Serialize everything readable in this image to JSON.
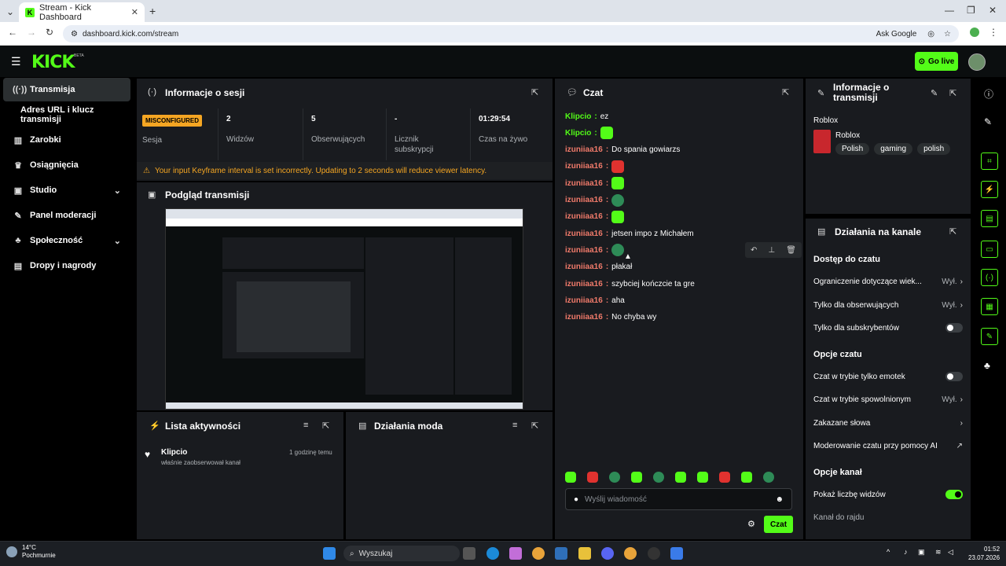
{
  "browser": {
    "tab_title": "Stream - Kick Dashboard",
    "url": "dashboard.kick.com/stream",
    "ask_google": "Ask Google"
  },
  "header": {
    "logo": "KICK",
    "beta": "BETA",
    "go_live": "Go live"
  },
  "sidebar": {
    "items": [
      {
        "label": "Transmisja",
        "icon": "broadcast-icon"
      },
      {
        "label": "Adres URL i klucz transmisji",
        "icon": ""
      },
      {
        "label": "Zarobki",
        "icon": "chart-icon"
      },
      {
        "label": "Osiągnięcia",
        "icon": "trophy-icon"
      },
      {
        "label": "Studio",
        "icon": "studio-icon"
      },
      {
        "label": "Panel moderacji",
        "icon": "wrench-icon"
      },
      {
        "label": "Społeczność",
        "icon": "community-icon"
      },
      {
        "label": "Dropy i nagrody",
        "icon": "gift-icon"
      }
    ]
  },
  "session": {
    "title": "Informacje o sesji",
    "badge": "MISCONFIGURED",
    "status_label": "Sesja",
    "stats": [
      {
        "value": "2",
        "label": "Widzów"
      },
      {
        "value": "5",
        "label": "Obserwujących"
      },
      {
        "value": "-",
        "label": "Licznik subskrypcji"
      },
      {
        "value": "01:29:54",
        "label": "Czas na żywo"
      }
    ],
    "warning": "Your input Keyframe interval is set incorrectly. Updating to 2 seconds will reduce viewer latency."
  },
  "preview": {
    "title": "Podgląd transmisji"
  },
  "activity": {
    "title": "Lista aktywności",
    "items": [
      {
        "user": "Klipcio",
        "text": "właśnie zaobserwował kanał",
        "time": "1 godzinę temu"
      }
    ]
  },
  "mod_actions": {
    "title": "Działania moda"
  },
  "chat": {
    "title": "Czat",
    "messages": [
      {
        "user": "Klipcio",
        "text": "ez",
        "color": "#53fc18",
        "emote": ""
      },
      {
        "user": "Klipcio",
        "text": "",
        "color": "#53fc18",
        "emote": "green"
      },
      {
        "user": "izuniiaa16",
        "text": "Do spania gowiarzs",
        "color": "#f07a6a",
        "emote": ""
      },
      {
        "user": "izuniiaa16",
        "text": "",
        "color": "#f07a6a",
        "emote": "red"
      },
      {
        "user": "izuniiaa16",
        "text": "",
        "color": "#f07a6a",
        "emote": "green"
      },
      {
        "user": "izuniiaa16",
        "text": "",
        "color": "#f07a6a",
        "emote": "globe"
      },
      {
        "user": "izuniiaa16",
        "text": "",
        "color": "#f07a6a",
        "emote": "green"
      },
      {
        "user": "izuniiaa16",
        "text": "jetsen impo z Michałem",
        "color": "#f07a6a",
        "emote": ""
      },
      {
        "user": "izuniiaa16",
        "text": "",
        "color": "#f07a6a",
        "emote": "globe"
      },
      {
        "user": "izuniiaa16",
        "text": "płakał",
        "color": "#f07a6a",
        "emote": ""
      },
      {
        "user": "izuniiaa16",
        "text": "szybciej kończcie ta gre",
        "color": "#f07a6a",
        "emote": ""
      },
      {
        "user": "izuniiaa16",
        "text": "aha",
        "color": "#f07a6a",
        "emote": ""
      },
      {
        "user": "izuniiaa16",
        "text": "No chyba wy",
        "color": "#f07a6a",
        "emote": ""
      }
    ],
    "input_placeholder": "Wyślij wiadomość",
    "send": "Czat"
  },
  "stream_info": {
    "title": "Informacje o transmisji",
    "category_header": "Roblox",
    "category": "Roblox",
    "tags": [
      "Polish",
      "gaming",
      "polish"
    ]
  },
  "channel_actions": {
    "title": "Działania na kanale",
    "sections": [
      {
        "heading": "Dostęp do czatu",
        "rows": [
          {
            "label": "Ograniczenie dotyczące wiek...",
            "value": "Wył.",
            "control": "arrow"
          },
          {
            "label": "Tylko dla obserwujących",
            "value": "Wył.",
            "control": "arrow"
          },
          {
            "label": "Tylko dla subskrybentów",
            "value": "",
            "control": "toggle-off"
          }
        ]
      },
      {
        "heading": "Opcje czatu",
        "rows": [
          {
            "label": "Czat w trybie tylko emotek",
            "value": "",
            "control": "toggle-off"
          },
          {
            "label": "Czat w trybie spowolnionym",
            "value": "Wył.",
            "control": "arrow"
          },
          {
            "label": "Zakazane słowa",
            "value": "",
            "control": "arrow"
          },
          {
            "label": "Moderowanie czatu przy pomocy AI",
            "value": "",
            "control": "external"
          }
        ]
      },
      {
        "heading": "Opcje kanał",
        "rows": [
          {
            "label": "Pokaż liczbę widzów",
            "value": "",
            "control": "toggle-on"
          },
          {
            "label": "Kanał do rajdu",
            "value": "",
            "control": "none"
          }
        ]
      }
    ]
  },
  "taskbar": {
    "weather_temp": "14°C",
    "weather_desc": "Pochmurnie",
    "search": "Wyszukaj",
    "time": "01:52",
    "date": "23.07.2026"
  },
  "colors": {
    "accent": "#53fc18",
    "warning": "#f5a623",
    "panel": "#191b1f"
  }
}
